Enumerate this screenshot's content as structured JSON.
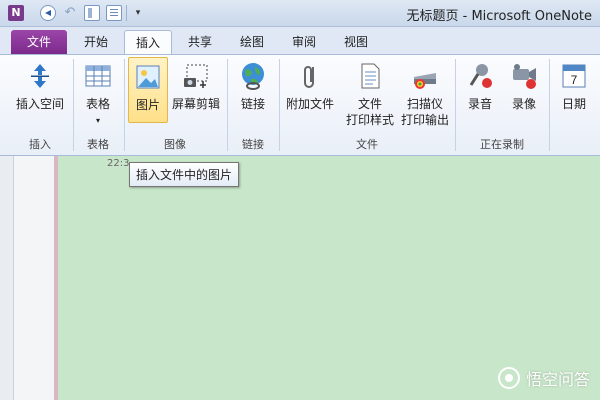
{
  "window": {
    "app_icon_letter": "N",
    "title": "无标题页 - Microsoft OneNote"
  },
  "tabs": [
    {
      "label": "文件"
    },
    {
      "label": "开始"
    },
    {
      "label": "插入"
    },
    {
      "label": "共享"
    },
    {
      "label": "绘图"
    },
    {
      "label": "审阅"
    },
    {
      "label": "视图"
    }
  ],
  "active_tab": "插入",
  "ribbon": {
    "insert_space": "插入空间",
    "table": "表格",
    "picture": "图片",
    "screen_clip": "屏幕剪辑",
    "link": "链接",
    "attach_file": "附加文件",
    "file_printout_1": "文件",
    "file_printout_2": "打印样式",
    "scanner_1": "扫描仪",
    "scanner_2": "打印输出",
    "record_audio": "录音",
    "record_video": "录像",
    "date": "日期",
    "groups": {
      "insert": "插入",
      "tables": "表格",
      "images": "图像",
      "links": "链接",
      "files": "文件",
      "recording": "正在录制"
    }
  },
  "page": {
    "timestamp": "22:3",
    "tooltip": "插入文件中的图片"
  },
  "watermark": "悟空问答",
  "icons": [
    "back-icon",
    "undo-icon",
    "normal-view-icon",
    "dock-icon",
    "insert-space-icon",
    "table-icon",
    "picture-icon",
    "screen-clip-icon",
    "link-icon",
    "attach-icon",
    "file-printout-icon",
    "scanner-icon",
    "audio-icon",
    "video-icon",
    "calendar-icon"
  ]
}
